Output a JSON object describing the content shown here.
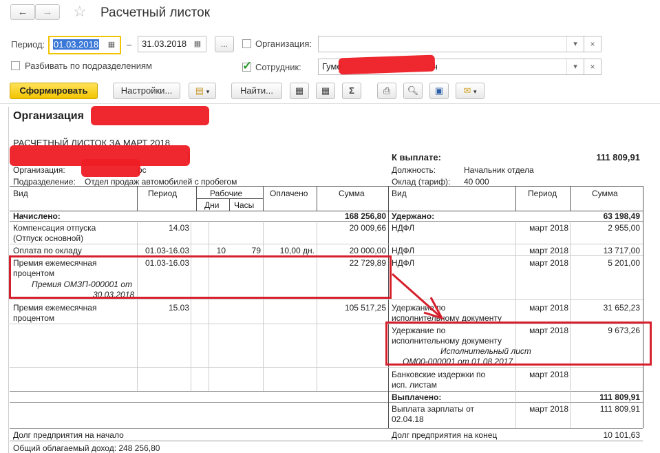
{
  "window": {
    "title": "Расчетный листок"
  },
  "filters": {
    "period_label": "Период:",
    "date_from": "01.03.2018",
    "dash": "–",
    "date_to": "31.03.2018",
    "more": "...",
    "org_label": "Организация:",
    "org_value": "",
    "split_label": "Разбивать по подразделениям",
    "emp_label": "Сотрудник:",
    "emp_value": "Гуме",
    "emp_value_tail": "ч"
  },
  "toolbar": {
    "generate": "Сформировать",
    "settings": "Настройки...",
    "find": "Найти...",
    "sum": "Σ"
  },
  "report": {
    "org_header": "Организация",
    "title": "РАСЧЕТНЫЙ ЛИСТОК ЗА МАРТ 2018",
    "name_tail": ")",
    "org_label": "Организация:",
    "org_tail": "рс",
    "dept_label": "Подразделение:",
    "dept_value": "Отдел продаж автомобилей с пробегом",
    "to_pay_label": "К выплате:",
    "to_pay_value": "111 809,91",
    "position_label": "Должность:",
    "position_value": "Начальник отдела",
    "salary_label": "Оклад (тариф):",
    "salary_value": "40 000",
    "left_headers": {
      "kind": "Вид",
      "period": "Период",
      "working": "Рабочие",
      "days": "Дни",
      "hours": "Часы",
      "paid": "Оплачено",
      "sum": "Сумма"
    },
    "right_headers": {
      "kind": "Вид",
      "period": "Период",
      "sum": "Сумма"
    },
    "accrued_label": "Начислено:",
    "accrued_total": "168 256,80",
    "withheld_label": "Удержано:",
    "withheld_total": "63 198,49",
    "accruals": [
      {
        "kind": "Компенсация отпуска",
        "kind2": "(Отпуск основной)",
        "period": "14.03",
        "days": "",
        "hours": "",
        "paid": "",
        "sum": "20 009,66"
      },
      {
        "kind": "Оплата по окладу",
        "period": "01.03-16.03",
        "days": "10",
        "hours": "79",
        "paid": "10,00 дн.",
        "sum": "20 000,00"
      },
      {
        "kind": "Премия ежемесячная",
        "kind2": "процентом",
        "note": "Премия ОМЗП-000001 от",
        "note2": "30.03.2018",
        "period": "01.03-16.03",
        "sum": "22 729,89"
      },
      {
        "kind": "Премия ежемесячная",
        "kind2": "процентом",
        "period": "15.03",
        "sum": "105 517,25"
      }
    ],
    "withholdings": [
      {
        "kind": "НДФЛ",
        "period": "март 2018",
        "sum": "2 955,00"
      },
      {
        "kind": "НДФЛ",
        "period": "март 2018",
        "sum": "13 717,00"
      },
      {
        "kind": "НДФЛ",
        "period": "март 2018",
        "sum": "5 201,00"
      },
      {
        "kind": "Удержание по",
        "kind2": "исполнительному документу",
        "period": "март 2018",
        "sum": "31 652,23"
      },
      {
        "kind": "Удержание по",
        "kind2": "исполнительному документу",
        "note": "Исполнительный лист",
        "note2": "ОМ00-000001 от 01.08.2017",
        "period": "март 2018",
        "sum": "9 673,26"
      },
      {
        "kind": "Банковские издержки по",
        "kind2": "исп. листам",
        "period": "март 2018",
        "sum": ""
      }
    ],
    "paid_label": "Выплачено:",
    "paid_total": "111 809,91",
    "payout": {
      "kind": "Выплата зарплаты  от",
      "kind2": "02.04.18",
      "period": "март 2018",
      "sum": "111 809,91"
    },
    "debt_start_label": "Долг предприятия на начало",
    "debt_end_label": "Долг предприятия на конец",
    "debt_end_value": "10 101,63",
    "taxable_label": "Общий облагаемый доход: 248 256,80"
  },
  "colors": {
    "redaction": "#ee1c24",
    "highlight": "#d61f2c",
    "primary": "#f2c400"
  }
}
